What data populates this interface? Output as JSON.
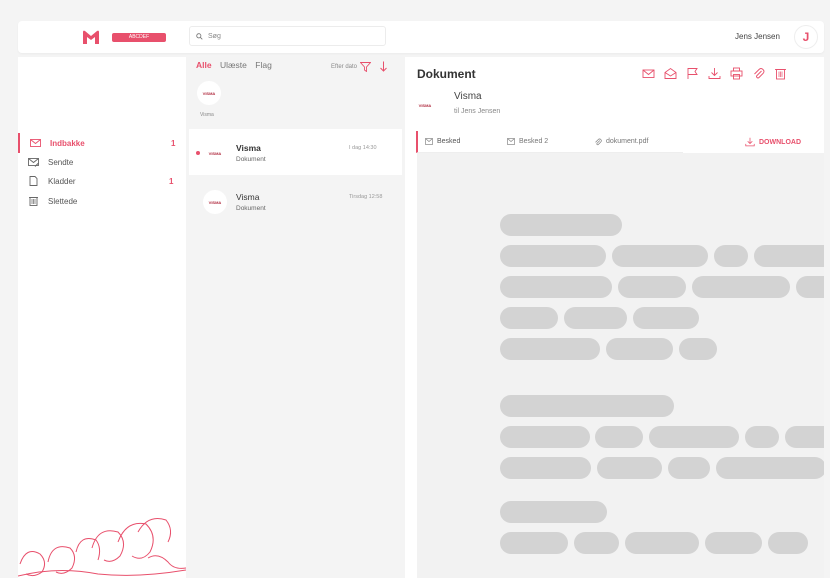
{
  "brand": {
    "pill_text": "ABCDEF",
    "accent": "#e8506c"
  },
  "search": {
    "placeholder": "Søg"
  },
  "user": {
    "name": "Jens Jensen",
    "initial": "J"
  },
  "sidebar": {
    "items": [
      {
        "label": "Indbakke",
        "count": "1",
        "icon": "inbox-icon",
        "active": true
      },
      {
        "label": "Sendte",
        "count": "",
        "icon": "send-icon",
        "active": false
      },
      {
        "label": "Kladder",
        "count": "1",
        "icon": "draft-icon",
        "active": false
      },
      {
        "label": "Slettede",
        "count": "",
        "icon": "trash-icon",
        "active": false
      }
    ]
  },
  "list": {
    "filters": [
      "Alle",
      "Ulæste",
      "Flag"
    ],
    "sort_label": "Efter dato",
    "sender": {
      "logo": "VISMA",
      "name": "Visma"
    },
    "messages": [
      {
        "logo": "VISMA",
        "from": "Visma",
        "subject": "Dokument",
        "time": "I dag 14:30",
        "unread": true
      },
      {
        "logo": "VISMA",
        "from": "Visma",
        "subject": "Dokument",
        "time": "Tirsdag 12:58",
        "unread": false
      }
    ]
  },
  "reader": {
    "title": "Dokument",
    "toolbar_icons": [
      "mail-icon",
      "mail-open-icon",
      "flag-icon",
      "download-icon",
      "print-icon",
      "attachment-icon",
      "trash-icon"
    ],
    "sender_logo": "VISMA",
    "from": "Visma",
    "to": "til Jens Jensen",
    "tabs": [
      "Besked",
      "Besked 2",
      "dokument.pdf"
    ],
    "download_label": "DOWNLOAD"
  }
}
